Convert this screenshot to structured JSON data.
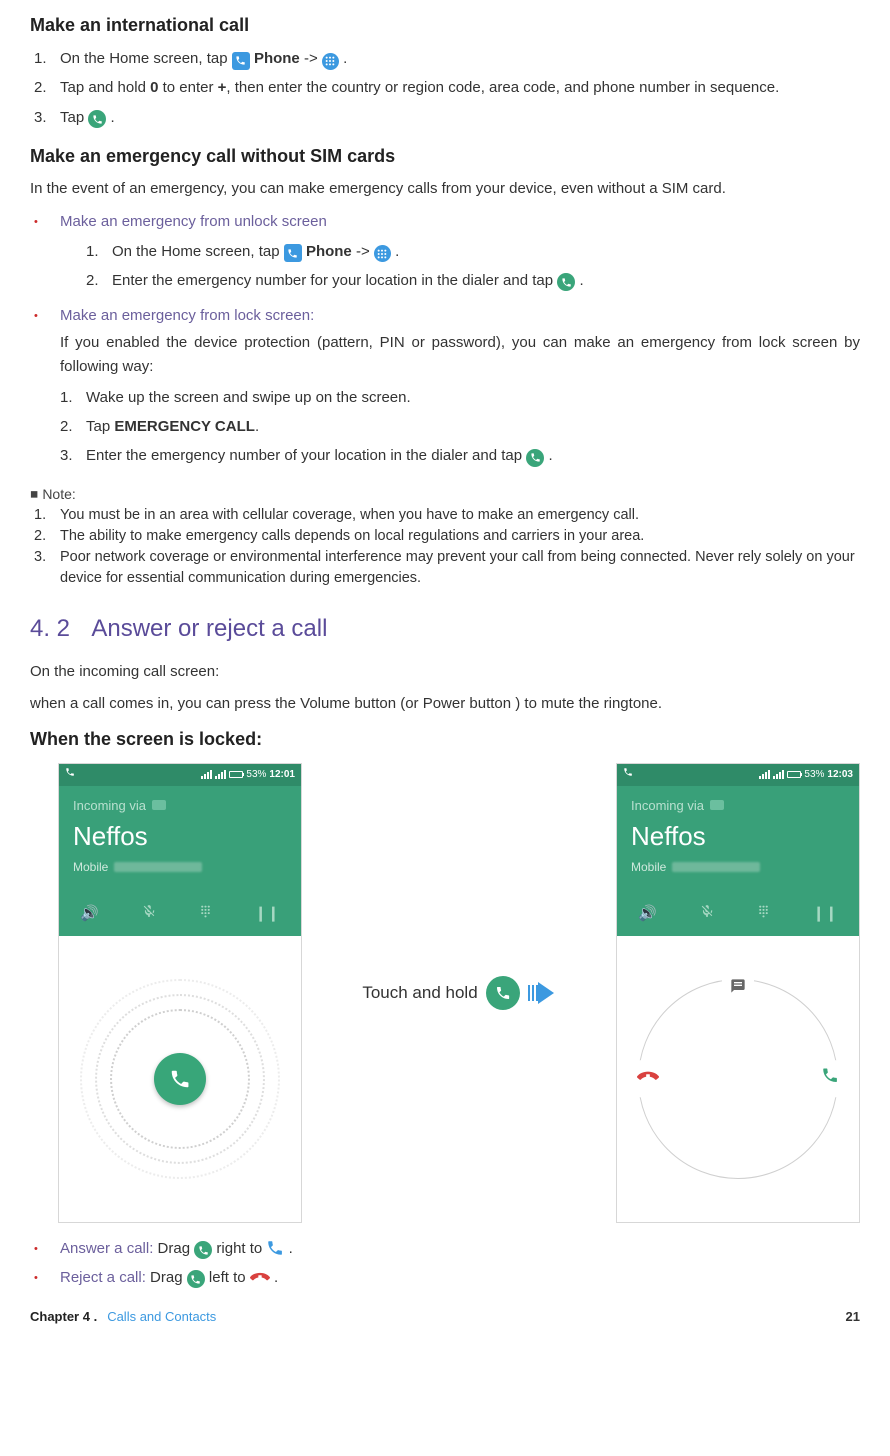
{
  "sections": {
    "intl": {
      "title": "Make an international call",
      "steps": {
        "s1a": "On the Home screen, tap ",
        "s1b": " -> ",
        "s1c": ".",
        "phone_label": "Phone",
        "s2a": "Tap and hold ",
        "s2_zero": "0",
        "s2b": " to enter ",
        "s2_plus": "+",
        "s2c": ", then enter the country or region code, area code, and phone number in sequence.",
        "s3a": "Tap ",
        "s3b": "."
      }
    },
    "emerg": {
      "title": "Make an emergency call without SIM cards",
      "intro": "In the event of an emergency, you can make emergency calls from your device, even without a SIM card.",
      "unlock_label": "Make an emergency from unlock screen",
      "unlock_steps": {
        "s1a": "On the Home screen, tap ",
        "s1b": " -> ",
        "s1c": ".",
        "phone_label": "Phone",
        "s2a": "Enter the emergency number for your location in the dialer and tap ",
        "s2b": "."
      },
      "lock_label": "Make an emergency from lock screen:",
      "lock_intro": "If you enabled the device protection (pattern, PIN or password), you can make an emergency from lock screen by following way:",
      "lock_steps": {
        "s1": "Wake up the screen and swipe up on the screen.",
        "s2a": "Tap ",
        "s2_bold": "EMERGENCY CALL",
        "s2b": ".",
        "s3a": "Enter the emergency number of your location in the dialer and tap ",
        "s3b": "."
      }
    },
    "note": {
      "label": "Note:",
      "items": [
        "You must be in an area with cellular coverage, when you have to make an emergency call.",
        "The ability to make emergency calls depends on local regulations and carriers in your area.",
        "Poor network coverage or environmental interference may prevent your call from being connected. Never rely solely on your device for essential communication during emergencies."
      ]
    },
    "answer": {
      "num": "4. 2",
      "title": "Answer or reject a call",
      "p1": "On the incoming call screen:",
      "p2": "when a call comes in, you can press the Volume button (or Power button ) to mute the ringtone.",
      "locked_title": "When the screen is locked:",
      "touch_hold": "Touch and hold",
      "answer_label": "Answer a call:",
      "answer_a": " Drag ",
      "answer_b": " right to ",
      "answer_c": ".",
      "reject_label": "Reject a call:",
      "reject_a": " Drag ",
      "reject_b": " left to ",
      "reject_c": "."
    }
  },
  "phone_left": {
    "time": "12:01",
    "batt_pct": "53%",
    "incoming": "Incoming via",
    "name": "Neffos",
    "carrier": "Mobile"
  },
  "phone_right": {
    "time": "12:03",
    "batt_pct": "53%",
    "incoming": "Incoming via",
    "name": "Neffos",
    "carrier": "Mobile"
  },
  "footer": {
    "chapter": "Chapter 4 .",
    "title": "Calls and Contacts",
    "page": "21"
  }
}
